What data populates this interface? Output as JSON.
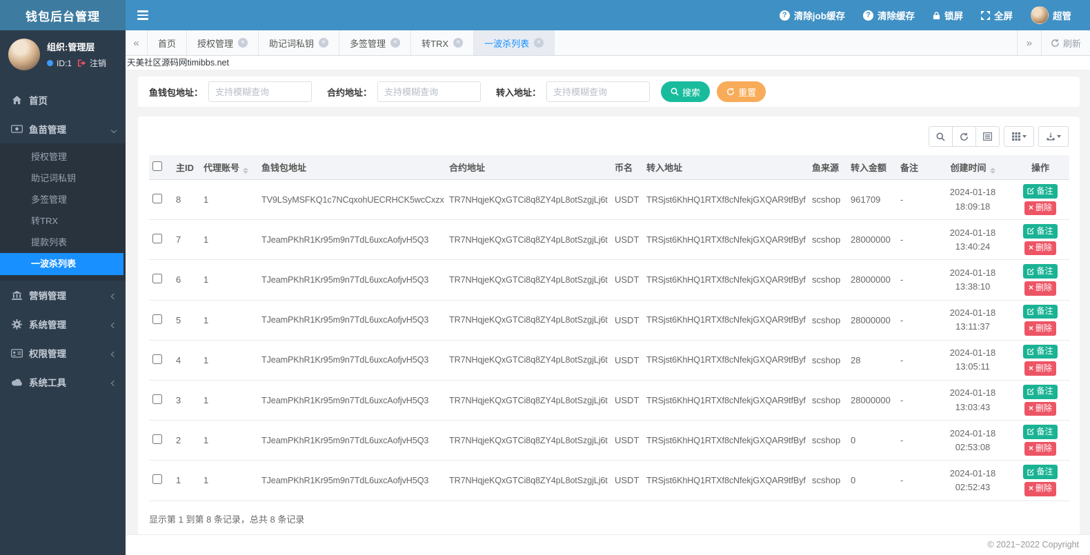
{
  "header": {
    "logo": "钱包后台管理",
    "nav": [
      {
        "label": "清除job缓存",
        "icon": "question-circle-icon"
      },
      {
        "label": "清除缓存",
        "icon": "question-circle-icon"
      },
      {
        "label": "锁屏",
        "icon": "lock-icon"
      },
      {
        "label": "全屏",
        "icon": "fullscreen-icon"
      },
      {
        "label": "超管",
        "icon": "avatar"
      }
    ]
  },
  "sidebar": {
    "org": "组织:管理层",
    "user_id": "ID:1",
    "logout": "注销",
    "menu": [
      {
        "label": "首页",
        "icon": "home-icon"
      },
      {
        "label": "鱼苗管理",
        "icon": "money-icon",
        "expanded": true,
        "children": [
          "授权管理",
          "助记词私钥",
          "多签管理",
          "转TRX",
          "提款列表",
          "一波杀列表"
        ],
        "active_child": 5
      },
      {
        "label": "营销管理",
        "icon": "bank-icon"
      },
      {
        "label": "系统管理",
        "icon": "gear-icon"
      },
      {
        "label": "权限管理",
        "icon": "idcard-icon"
      },
      {
        "label": "系统工具",
        "icon": "cloud-icon"
      }
    ]
  },
  "tabs": {
    "items": [
      {
        "label": "首页",
        "closable": false,
        "active": false
      },
      {
        "label": "授权管理",
        "closable": true,
        "active": false
      },
      {
        "label": "助记词私钥",
        "closable": true,
        "active": false
      },
      {
        "label": "多签管理",
        "closable": true,
        "active": false
      },
      {
        "label": "转TRX",
        "closable": true,
        "active": false
      },
      {
        "label": "一波杀列表",
        "closable": true,
        "active": true
      }
    ],
    "refresh_label": "刷新"
  },
  "breadcrumb": "天美社区源码网timibbs.net",
  "filters": {
    "fields": [
      {
        "label": "鱼钱包地址：",
        "placeholder": "支持模糊查询"
      },
      {
        "label": "合约地址：",
        "placeholder": "支持模糊查询"
      },
      {
        "label": "转入地址：",
        "placeholder": "支持模糊查询"
      }
    ],
    "search_label": "搜索",
    "reset_label": "重置"
  },
  "table": {
    "columns": [
      "主ID",
      "代理账号",
      "鱼钱包地址",
      "合约地址",
      "币名",
      "转入地址",
      "鱼来源",
      "转入金额",
      "备注",
      "创建时间",
      "操作"
    ],
    "actions": {
      "note": "备注",
      "delete": "删除"
    },
    "rows": [
      {
        "id": "8",
        "agent": "1",
        "wallet": "TV9LSyMSFKQ1c7NCqxohUECRHCK5wcCxzx",
        "contract": "TR7NHqjeKQxGTCi8q8ZY4pL8otSzgjLj6t",
        "coin": "USDT",
        "to": "TRSjst6KhHQ1RTXf8cNfekjGXQAR9tfByf",
        "source": "scshop",
        "amount": "961709",
        "remark": "-",
        "date": "2024-01-18",
        "time": "18:09:18"
      },
      {
        "id": "7",
        "agent": "1",
        "wallet": "TJeamPKhR1Kr95m9n7TdL6uxcAofjvH5Q3",
        "contract": "TR7NHqjeKQxGTCi8q8ZY4pL8otSzgjLj6t",
        "coin": "USDT",
        "to": "TRSjst6KhHQ1RTXf8cNfekjGXQAR9tfByf",
        "source": "scshop",
        "amount": "28000000",
        "remark": "-",
        "date": "2024-01-18",
        "time": "13:40:24"
      },
      {
        "id": "6",
        "agent": "1",
        "wallet": "TJeamPKhR1Kr95m9n7TdL6uxcAofjvH5Q3",
        "contract": "TR7NHqjeKQxGTCi8q8ZY4pL8otSzgjLj6t",
        "coin": "USDT",
        "to": "TRSjst6KhHQ1RTXf8cNfekjGXQAR9tfByf",
        "source": "scshop",
        "amount": "28000000",
        "remark": "-",
        "date": "2024-01-18",
        "time": "13:38:10"
      },
      {
        "id": "5",
        "agent": "1",
        "wallet": "TJeamPKhR1Kr95m9n7TdL6uxcAofjvH5Q3",
        "contract": "TR7NHqjeKQxGTCi8q8ZY4pL8otSzgjLj6t",
        "coin": "USDT",
        "to": "TRSjst6KhHQ1RTXf8cNfekjGXQAR9tfByf",
        "source": "scshop",
        "amount": "28000000",
        "remark": "-",
        "date": "2024-01-18",
        "time": "13:11:37"
      },
      {
        "id": "4",
        "agent": "1",
        "wallet": "TJeamPKhR1Kr95m9n7TdL6uxcAofjvH5Q3",
        "contract": "TR7NHqjeKQxGTCi8q8ZY4pL8otSzgjLj6t",
        "coin": "USDT",
        "to": "TRSjst6KhHQ1RTXf8cNfekjGXQAR9tfByf",
        "source": "scshop",
        "amount": "28",
        "remark": "-",
        "date": "2024-01-18",
        "time": "13:05:11"
      },
      {
        "id": "3",
        "agent": "1",
        "wallet": "TJeamPKhR1Kr95m9n7TdL6uxcAofjvH5Q3",
        "contract": "TR7NHqjeKQxGTCi8q8ZY4pL8otSzgjLj6t",
        "coin": "USDT",
        "to": "TRSjst6KhHQ1RTXf8cNfekjGXQAR9tfByf",
        "source": "scshop",
        "amount": "28000000",
        "remark": "-",
        "date": "2024-01-18",
        "time": "13:03:43"
      },
      {
        "id": "2",
        "agent": "1",
        "wallet": "TJeamPKhR1Kr95m9n7TdL6uxcAofjvH5Q3",
        "contract": "TR7NHqjeKQxGTCi8q8ZY4pL8otSzgjLj6t",
        "coin": "USDT",
        "to": "TRSjst6KhHQ1RTXf8cNfekjGXQAR9tfByf",
        "source": "scshop",
        "amount": "0",
        "remark": "-",
        "date": "2024-01-18",
        "time": "02:53:08"
      },
      {
        "id": "1",
        "agent": "1",
        "wallet": "TJeamPKhR1Kr95m9n7TdL6uxcAofjvH5Q3",
        "contract": "TR7NHqjeKQxGTCi8q8ZY4pL8otSzgjLj6t",
        "coin": "USDT",
        "to": "TRSjst6KhHQ1RTXf8cNfekjGXQAR9tfByf",
        "source": "scshop",
        "amount": "0",
        "remark": "-",
        "date": "2024-01-18",
        "time": "02:52:43"
      }
    ]
  },
  "pagination_info": "显示第 1 到第 8 条记录，总共 8 条记录",
  "footer": "© 2021~2022 Copyright",
  "colors": {
    "header_blue": "#3f90c4",
    "logo_blue": "#3d7ba0",
    "sidebar_dark": "#2d3c4b",
    "active_blue": "#1890ff",
    "search_green": "#18bc9c",
    "reset_orange": "#f8ac59",
    "note_green": "#1ab394",
    "delete_red": "#ed5565"
  }
}
